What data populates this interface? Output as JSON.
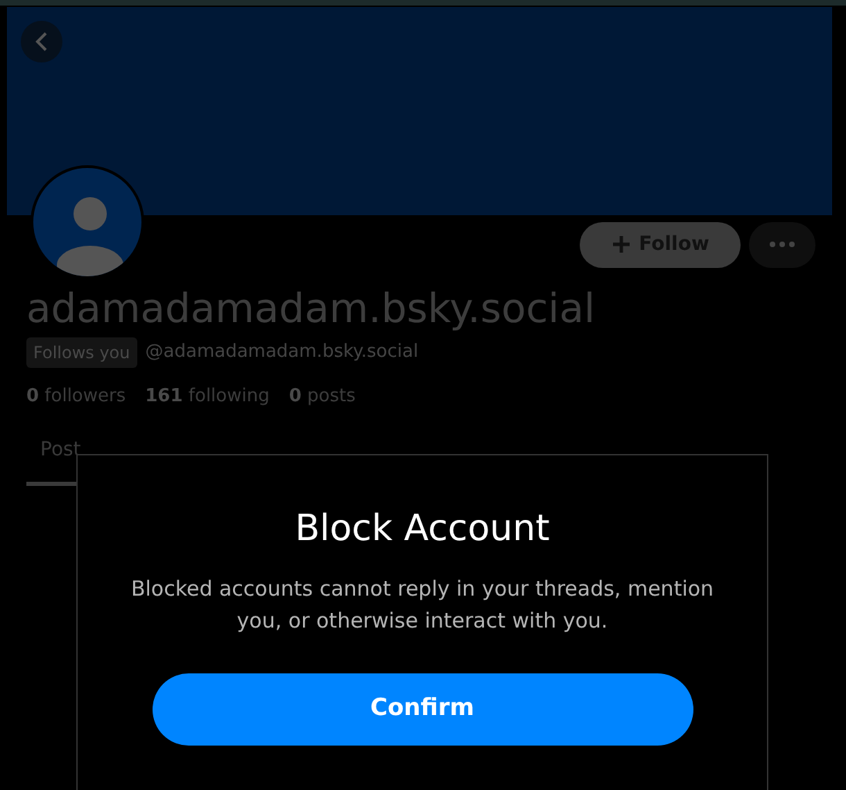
{
  "profile": {
    "display_name": "adamadamadam.bsky.social",
    "badge": "Follows you",
    "handle": "@adamadamadam.bsky.social",
    "stats": [
      {
        "count": "0",
        "label": "followers"
      },
      {
        "count": "161",
        "label": "following"
      },
      {
        "count": "0",
        "label": "posts"
      }
    ],
    "follow_button": "Follow"
  },
  "tabs": [
    {
      "label": "Post",
      "selected": true
    }
  ],
  "dialog": {
    "title": "Block Account",
    "message": "Blocked accounts cannot reply in your threads, mention you, or otherwise interact with you.",
    "confirm_button": "Confirm"
  }
}
